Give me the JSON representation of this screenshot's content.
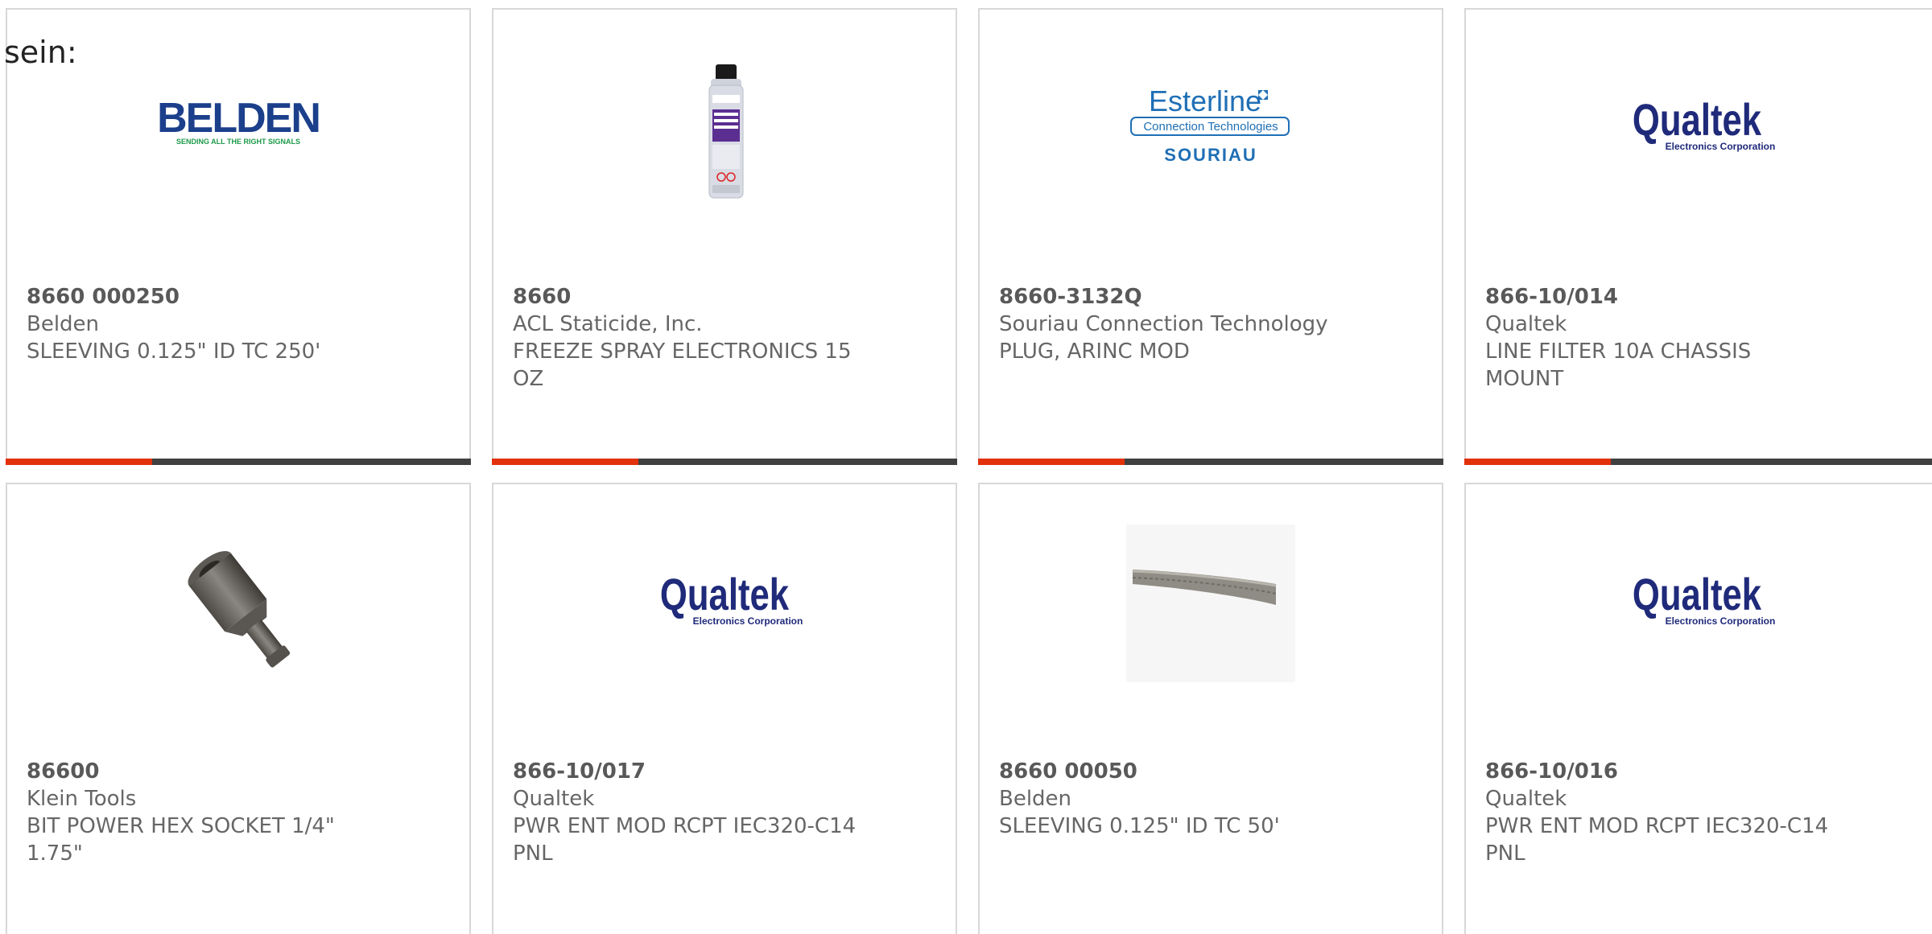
{
  "header": {
    "fragment": "sein:"
  },
  "colors": {
    "accent": "#e2310b",
    "bar": "#404040",
    "border": "#d8d8d8",
    "text": "#666666",
    "qualtek_blue": "#1f2a7a",
    "belden_blue": "#1b3f8b",
    "belden_green": "#1d9a4a",
    "esterline_blue": "#1f6fb5"
  },
  "products": [
    {
      "part_number": "8660 000250",
      "manufacturer": "Belden",
      "description": "SLEEVING 0.125\" ID TC 250'",
      "image": "belden-logo",
      "logo_text": "BELDEN",
      "logo_tagline": "SENDING ALL THE RIGHT SIGNALS"
    },
    {
      "part_number": "8660",
      "manufacturer": "ACL Staticide, Inc.",
      "description": "FREEZE SPRAY ELECTRONICS 15 OZ",
      "image": "spray-can"
    },
    {
      "part_number": "8660-3132Q",
      "manufacturer": "Souriau Connection Technology",
      "description": "PLUG, ARINC MOD",
      "image": "esterline-logo",
      "logo_text": "Esterline",
      "logo_line2": "Connection Technologies",
      "logo_line3": "SOURIAU"
    },
    {
      "part_number": "866-10/014",
      "manufacturer": "Qualtek",
      "description": "LINE FILTER 10A CHASSIS MOUNT",
      "image": "qualtek-logo",
      "logo_text": "Qualtek",
      "logo_tagline": "Electronics Corporation"
    },
    {
      "part_number": "86600",
      "manufacturer": "Klein Tools",
      "description": "BIT POWER HEX SOCKET 1/4\" 1.75\"",
      "image": "hex-socket"
    },
    {
      "part_number": "866-10/017",
      "manufacturer": "Qualtek",
      "description": "PWR ENT MOD RCPT IEC320-C14 PNL",
      "image": "qualtek-logo",
      "logo_text": "Qualtek",
      "logo_tagline": "Electronics Corporation"
    },
    {
      "part_number": "8660 00050",
      "manufacturer": "Belden",
      "description": "SLEEVING 0.125\" ID TC 50'",
      "image": "braided-sleeving"
    },
    {
      "part_number": "866-10/016",
      "manufacturer": "Qualtek",
      "description": "PWR ENT MOD RCPT IEC320-C14 PNL",
      "image": "qualtek-logo",
      "logo_text": "Qualtek",
      "logo_tagline": "Electronics Corporation"
    }
  ]
}
